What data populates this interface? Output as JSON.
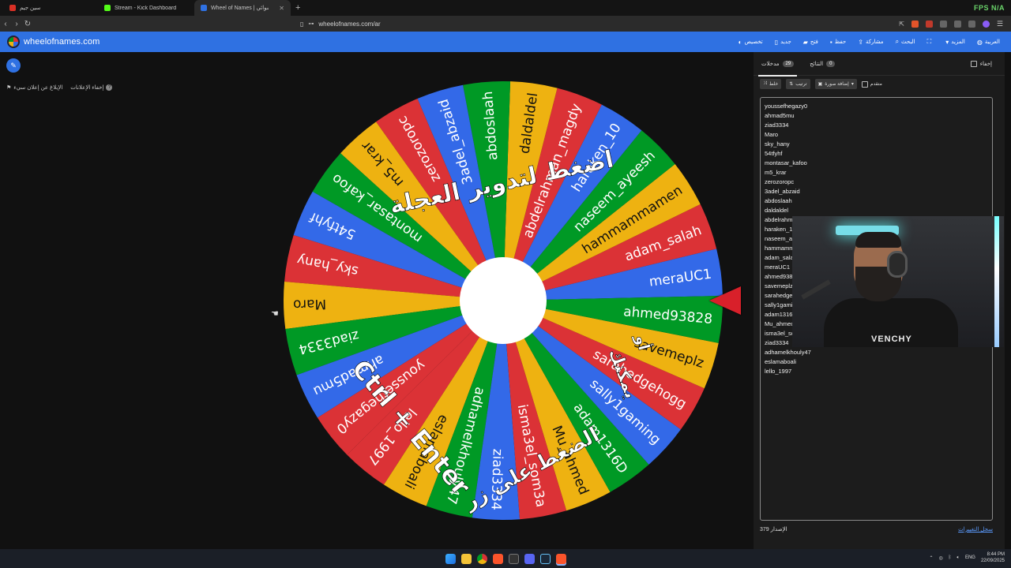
{
  "browser": {
    "tabs": [
      {
        "label": "سين جيم",
        "active": false,
        "color": "#d93025"
      },
      {
        "label": "Stream - Kick Dashboard",
        "active": false,
        "color": "#53fc18"
      },
      {
        "label": "Wheel of Names | اسم العشوائي",
        "active": true,
        "color": "#2f71e2"
      }
    ],
    "new_tab": "+",
    "url": "wheelofnames.com/ar",
    "fps_label": "FPS N/A"
  },
  "site": {
    "logo_text": "wheelofnames.com",
    "menu": [
      {
        "label": "العربية",
        "icon": "globe-icon"
      },
      {
        "label": "المزيد",
        "icon": "chevron-down-icon"
      },
      {
        "label": "",
        "icon": "fullscreen-icon"
      },
      {
        "label": "البحث",
        "icon": "search-icon"
      },
      {
        "label": "مشاركة",
        "icon": "share-icon"
      },
      {
        "label": "حفظ",
        "icon": "save-icon"
      },
      {
        "label": "فتح",
        "icon": "folder-icon"
      },
      {
        "label": "جديد",
        "icon": "file-icon"
      },
      {
        "label": "تخصيص",
        "icon": "palette-icon"
      }
    ]
  },
  "left": {
    "hide_ads": "إخفاء الإعلانات",
    "report_ad": "الإبلاغ عن إعلان سيء"
  },
  "wheel": {
    "colors": [
      "#db3236",
      "#3369e8",
      "#009925",
      "#eeb211"
    ],
    "center_color": "#ffffff",
    "pointer_color": "#d8202a",
    "overlay_text_top": "اضغط لتدوير العجلة",
    "overlay_text_or": "أو",
    "overlay_text_can": "يمكنك",
    "overlay_text_press": "الضغط على زر",
    "overlay_text_keys": "Ctrl + Enter"
  },
  "panel": {
    "tab_entries": "مدخلات",
    "entries_count": "29",
    "tab_results": "النتائج",
    "results_count": "0",
    "hide_label": "إخفاء",
    "shuffle_label": "خلط",
    "sort_label": "ترتيب",
    "add_image_label": "إضافة صورة",
    "advanced_label": "متقدم",
    "entries": [
      "youssefhegazy0",
      "ahmad5mu",
      "ziad3334",
      "Maro",
      "sky_hany",
      "54tfyhf",
      "montasar_kafoo",
      "m5_krar",
      "zerozoropc",
      "3adel_abzaid",
      "abdoslaah",
      "daldaldel",
      "abdelrahman_magdy",
      "haraken_10",
      "naseem_ayeesh",
      "hammammamen",
      "adam_salah",
      "meraUC1",
      "ahmed93828",
      "savemeplz",
      "sarahedgehogg",
      "sally1gaming",
      "adam1316D",
      "Mu_ahmed",
      "isma3el_som3a",
      "ziad3334",
      "adhamelkhouly47",
      "eslamaboali",
      "lello_1997"
    ],
    "version_label": "الإصدار",
    "version": "379",
    "changelog": "سجل التغييرات"
  },
  "webcam": {
    "shirt_text": "VENCHY"
  },
  "taskbar": {
    "lang": "ENG",
    "time": "8:44 PM",
    "date": "22/09/2025"
  }
}
